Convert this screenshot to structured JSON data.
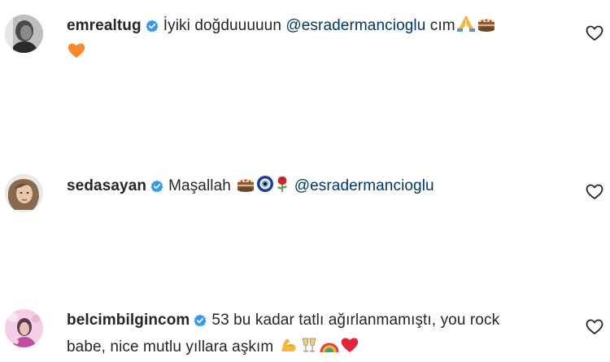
{
  "comments": [
    {
      "username": "emrealtug",
      "text_before": "İyiki doğduuuuun ",
      "mention": "@esradermancioglu",
      "text_after": " cım",
      "emojis": [
        "folded-hands-emoji",
        "birthday-cake-emoji",
        "orange-heart-emoji"
      ]
    },
    {
      "username": "sedasayan",
      "text_before": "Maşallah ",
      "mention": "@esradermancioglu",
      "text_after": "",
      "emojis": [
        "birthday-cake-emoji",
        "nazar-amulet-emoji",
        "rose-emoji"
      ]
    },
    {
      "username": "belcimbilgincom",
      "text_line1": "53 bu kadar tatlı ağırlanmamıştı, you rock",
      "text_line2": "babe, nice mutlu yıllara aşkım",
      "emojis": [
        "flexed-biceps-emoji",
        "clinking-glasses-emoji",
        "rainbow-emoji",
        "red-heart-emoji"
      ]
    }
  ],
  "colors": {
    "text": "#262626",
    "verified_badge": "#3897f0",
    "mention": "#00376b",
    "like_icon": "#262626"
  }
}
